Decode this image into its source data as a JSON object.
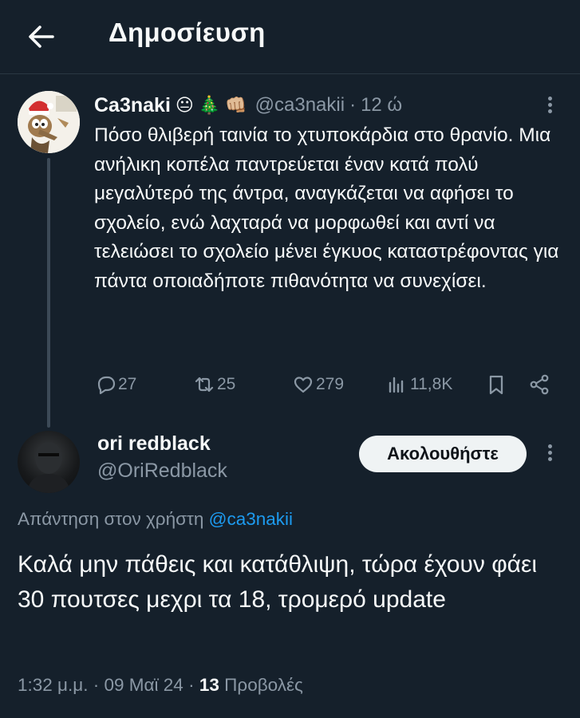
{
  "header": {
    "title": "Δημοσίευση",
    "back_icon": "arrow-left-icon"
  },
  "parent_tweet": {
    "author_name": "Ca3naki",
    "emojis": [
      "😐",
      "🎄",
      "👊🏼"
    ],
    "handle": "@ca3nakii",
    "time_separator": "·",
    "time": "12 ώ",
    "text": "Πόσο θλιβερή ταινία το χτυποκάρδια στο θρανίο. Μια ανήλικη κοπέλα παντρεύεται έναν κατά πολύ μεγαλύτερό της άντρα, αναγκάζεται να αφήσει το σχολείο, ενώ λαχταρά να μορφωθεί και αντί να τελειώσει το σχολείο μένει έγκυος καταστρέφοντας για πάντα οποιαδήποτε πιθανότητα να συνεχίσει.",
    "actions": {
      "replies": "27",
      "retweets": "25",
      "likes": "279",
      "views": "11,8K"
    }
  },
  "reply_tweet": {
    "author_name": "ori redblack",
    "handle": "@OriRedblack",
    "follow_label": "Ακολουθήστε",
    "replying_prefix": "Απάντηση στον χρήστη ",
    "replying_to": "@ca3nakii",
    "text": "Καλά μην πάθεις και κατάθλιψη, τώρα έχουν φάει 30 πουτσες μεχρι τα 18, τρομερό update",
    "time": "1:32 μ.μ.",
    "separator": "·",
    "date": "09 Μαϊ 24",
    "views_count": "13",
    "views_label": "Προβολές"
  },
  "colors": {
    "background": "#15202b",
    "text_primary": "#f7f9f9",
    "text_secondary": "#8b98a5",
    "link": "#1d9bf0",
    "follow_button_bg": "#eff3f4"
  }
}
